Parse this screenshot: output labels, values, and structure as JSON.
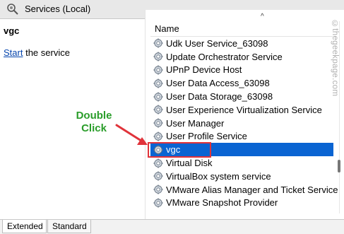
{
  "window": {
    "title": "Services (Local)",
    "icon": "magnifier-gear-icon"
  },
  "left_pane": {
    "service_name": "vgc",
    "start_link": "Start",
    "start_suffix": " the service"
  },
  "right_pane": {
    "sort_indicator": "^",
    "column_header": "Name",
    "services": [
      "Udk User Service_63098",
      "Update Orchestrator Service",
      "UPnP Device Host",
      "User Data Access_63098",
      "User Data Storage_63098",
      "User Experience Virtualization Service",
      "User Manager",
      "User Profile Service",
      "vgc",
      "Virtual Disk",
      "VirtualBox system service",
      "VMware Alias Manager and Ticket Service",
      "VMware Snapshot Provider"
    ],
    "selected_service": "vgc"
  },
  "annotation": {
    "line1": "Double",
    "line2": "Click",
    "text_color": "#2a9d2a",
    "arrow_color": "#e0333a",
    "box_color": "#e0333a"
  },
  "tabs": [
    {
      "label": "Extended",
      "active": true
    },
    {
      "label": "Standard",
      "active": false
    }
  ],
  "watermark": "©thegeekpage.com",
  "colors": {
    "selection": "#0a64d2",
    "link": "#0645ad"
  }
}
